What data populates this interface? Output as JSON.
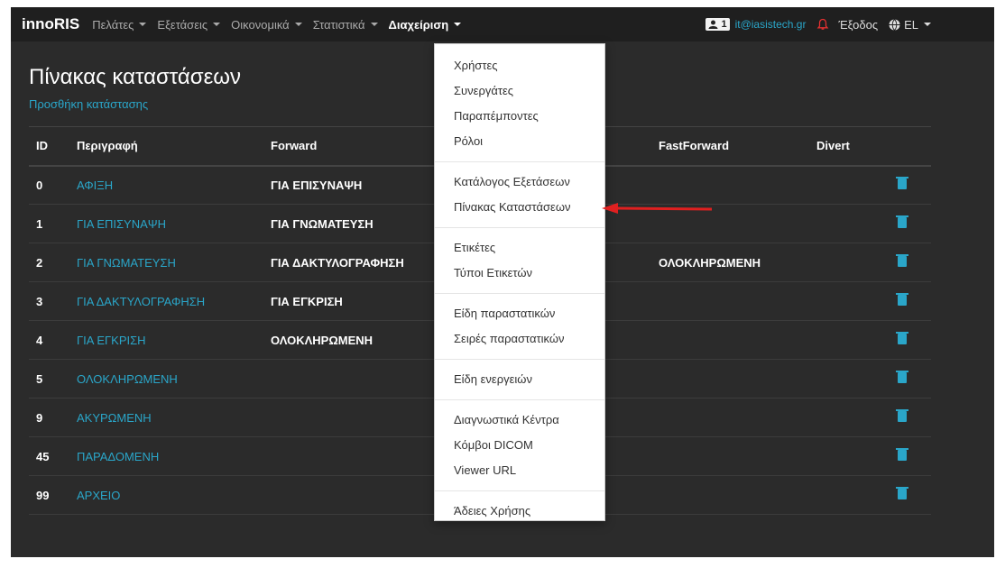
{
  "navbar": {
    "brand": "innoRIS",
    "menus": [
      "Πελάτες",
      "Εξετάσεις",
      "Οικονομικά",
      "Στατιστικά"
    ],
    "active_menu": "Διαχείριση",
    "user_count": "1",
    "user_email": "it@iasistech.gr",
    "logout": "Έξοδος",
    "language": "EL"
  },
  "page": {
    "title": "Πίνακας καταστάσεων",
    "add_link": "Προσθήκη κατάστασης"
  },
  "table": {
    "headers": [
      "ID",
      "Περιγραφή",
      "Forward",
      "",
      "FastForward",
      "Divert"
    ],
    "rows": [
      {
        "id": "0",
        "desc": "ΑΦΙΞΗ",
        "forward": "ΓΙΑ ΕΠΙΣΥΝΑΨΗ",
        "fastforward": ""
      },
      {
        "id": "1",
        "desc": "ΓΙΑ ΕΠΙΣΥΝΑΨΗ",
        "forward": "ΓΙΑ ΓΝΩΜΑΤΕΥΣΗ",
        "fastforward": ""
      },
      {
        "id": "2",
        "desc": "ΓΙΑ ΓΝΩΜΑΤΕΥΣΗ",
        "forward": "ΓΙΑ ΔΑΚΤΥΛΟΓΡΑΦΗΣΗ",
        "fastforward": "ΟΛΟΚΛΗΡΩΜΕΝΗ"
      },
      {
        "id": "3",
        "desc": "ΓΙΑ ΔΑΚΤΥΛΟΓΡΑΦΗΣΗ",
        "forward": "ΓΙΑ ΕΓΚΡΙΣΗ",
        "fastforward": ""
      },
      {
        "id": "4",
        "desc": "ΓΙΑ ΕΓΚΡΙΣΗ",
        "forward": "ΟΛΟΚΛΗΡΩΜΕΝΗ",
        "fastforward": ""
      },
      {
        "id": "5",
        "desc": "ΟΛΟΚΛΗΡΩΜΕΝΗ",
        "forward": "",
        "fastforward": ""
      },
      {
        "id": "9",
        "desc": "ΑΚΥΡΩΜΕΝΗ",
        "forward": "",
        "fastforward": ""
      },
      {
        "id": "45",
        "desc": "ΠΑΡΑΔΟΜΕΝΗ",
        "forward": "",
        "fastforward": ""
      },
      {
        "id": "99",
        "desc": "ΑΡΧΕΙΟ",
        "forward": "",
        "fastforward": ""
      }
    ]
  },
  "dropdown": {
    "groups": [
      [
        "Χρήστες",
        "Συνεργάτες",
        "Παραπέμποντες",
        "Ρόλοι"
      ],
      [
        "Κατάλογος Εξετάσεων",
        "Πίνακας Καταστάσεων"
      ],
      [
        "Ετικέτες",
        "Τύποι Ετικετών"
      ],
      [
        "Είδη παραστατικών",
        "Σειρές παραστατικών"
      ],
      [
        "Είδη ενεργειών"
      ],
      [
        "Διαγνωστικά Κέντρα",
        "Κόμβοι DICOM",
        "Viewer URL"
      ],
      [
        "Άδειες Χρήσης"
      ]
    ]
  },
  "colors": {
    "accent": "#2aa6c9",
    "annotation_arrow": "#e02020",
    "bell": "#e03030"
  }
}
